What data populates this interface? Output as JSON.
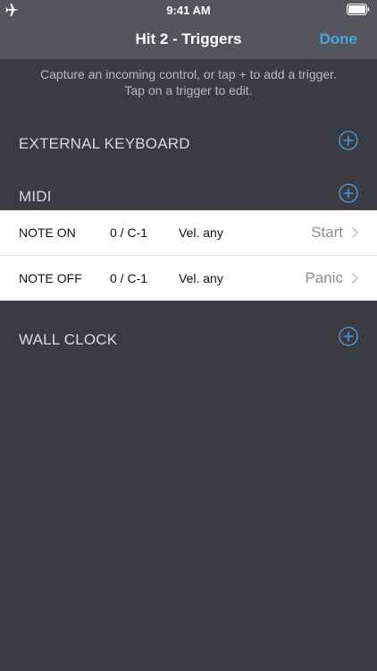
{
  "status_bar": {
    "time": "9:41 AM",
    "icons": [
      "airplane-icon",
      "battery-icon"
    ]
  },
  "nav": {
    "title": "Hit 2 - Triggers",
    "done_label": "Done"
  },
  "hint": {
    "line1": "Capture an incoming control, or tap + to add a trigger.",
    "line2": "Tap on a trigger to edit."
  },
  "sections": {
    "external_keyboard": "EXTERNAL KEYBOARD",
    "midi": "MIDI",
    "wall_clock": "WALL CLOCK"
  },
  "midi_triggers": [
    {
      "message": "NOTE ON",
      "note": "0 / C-1",
      "velocity": "Vel. any",
      "action": "Start"
    },
    {
      "message": "NOTE OFF",
      "note": "0 / C-1",
      "velocity": "Vel. any",
      "action": "Panic"
    }
  ],
  "colors": {
    "background": "#3b3b43",
    "bar": "#55555d",
    "accent": "#4aa3df",
    "row_background": "#ffffff"
  }
}
